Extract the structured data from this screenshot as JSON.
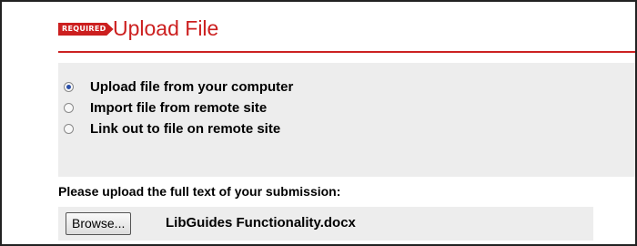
{
  "header": {
    "badge": "REQUIRED",
    "title": "Upload File",
    "accent_color": "#cc1f1f"
  },
  "upload_options": [
    {
      "label": "Upload file from your computer",
      "selected": true
    },
    {
      "label": "Import file from remote site",
      "selected": false
    },
    {
      "label": "Link out to file on remote site",
      "selected": false
    }
  ],
  "prompt": "Please upload the full text of your submission:",
  "file_input": {
    "button_label": "Browse...",
    "file_name": "LibGuides Functionality.docx"
  }
}
